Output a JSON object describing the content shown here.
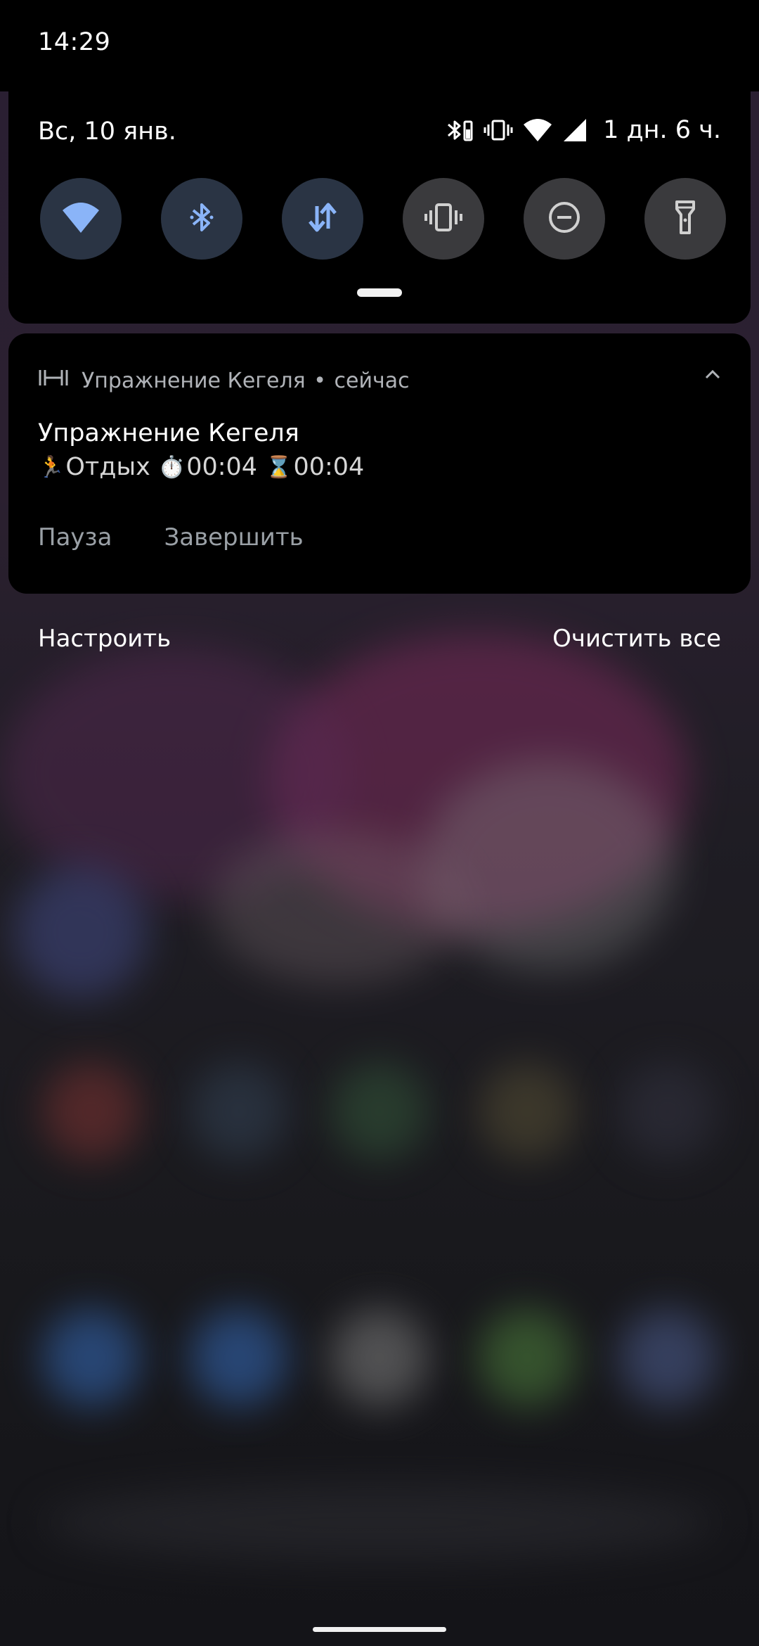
{
  "status_bar": {
    "time": "14:29"
  },
  "quick_settings": {
    "date": "Вс, 10 янв.",
    "battery_text": "1 дн. 6 ч.",
    "status_icons": [
      "bluetooth-icon",
      "vibrate-icon",
      "wifi-icon",
      "cell-signal-icon"
    ],
    "tiles": [
      {
        "icon": "wifi-icon",
        "state": "on"
      },
      {
        "icon": "bluetooth-icon",
        "state": "on"
      },
      {
        "icon": "mobile-data-icon",
        "state": "on"
      },
      {
        "icon": "vibrate-icon",
        "state": "off"
      },
      {
        "icon": "do-not-disturb-icon",
        "state": "off"
      },
      {
        "icon": "flashlight-icon",
        "state": "off"
      }
    ]
  },
  "notification": {
    "app_icon": "dumbbell-icon",
    "app_name": "Упражнение Кегеля",
    "separator": "•",
    "time": "сейчас",
    "title": "Упражнение Кегеля",
    "body": {
      "runner_emoji": "🏃",
      "status": "Отдых",
      "stopwatch_emoji": "⏱️",
      "elapsed": "00:04",
      "hourglass_emoji": "⌛",
      "remaining": "00:04"
    },
    "actions": {
      "pause": "Пауза",
      "finish": "Завершить"
    }
  },
  "footer": {
    "manage": "Настроить",
    "clear_all": "Очистить все"
  },
  "colors": {
    "accent": "#8ab4f8",
    "tile_on_bg": "#2a3444",
    "tile_off_bg": "#3a3a3d",
    "panel_bg": "#000000"
  }
}
